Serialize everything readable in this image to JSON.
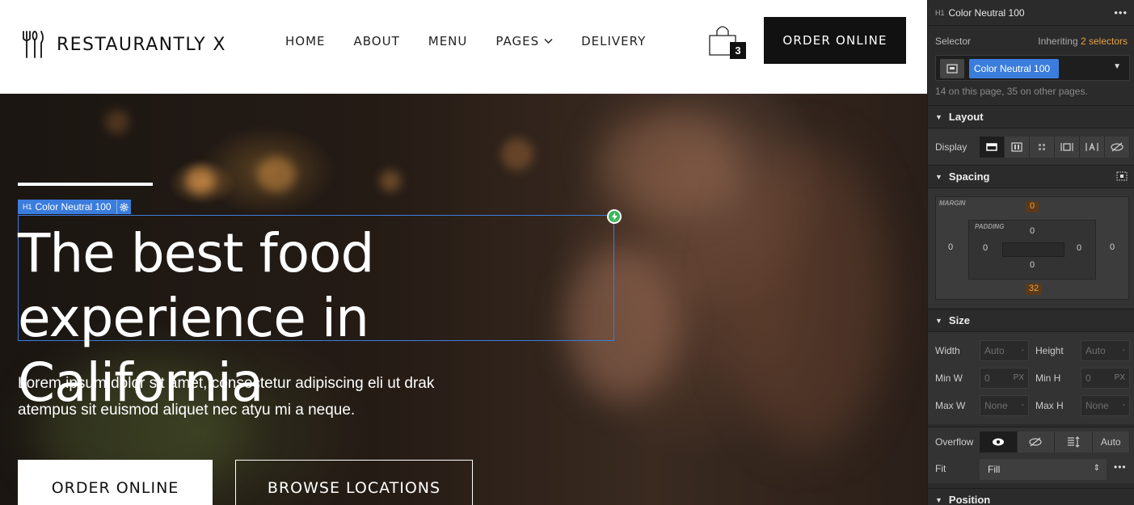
{
  "site": {
    "logo_text": "RESTAURANTLY X",
    "nav": [
      "HOME",
      "ABOUT",
      "MENU",
      "PAGES",
      "DELIVERY"
    ],
    "cart_count": "3",
    "order_button": "ORDER ONLINE"
  },
  "hero": {
    "selected_tag_type": "H1",
    "selected_tag_name": "Color Neutral 100",
    "heading_line1": "The best food",
    "heading_line2": "experience in California",
    "paragraph_line1": "Lorem ipsum dolor sit amet, consectetur adipiscing eli ut drak",
    "paragraph_line2": "atempus sit euismod aliquet nec atyu mi a neque.",
    "order_button": "ORDER ONLINE",
    "browse_button": "BROWSE LOCATIONS"
  },
  "panel": {
    "header_type": "H1",
    "header_name": "Color Neutral 100",
    "selector_label": "Selector",
    "inheriting_prefix": "Inheriting",
    "inheriting_count": "2 selectors",
    "selector_token": "Color Neutral 100",
    "usage_text": "14 on this page, 35 on other pages.",
    "sections": {
      "layout": "Layout",
      "spacing": "Spacing",
      "size": "Size",
      "position": "Position"
    },
    "display_label": "Display",
    "spacing": {
      "margin_label": "MARGIN",
      "padding_label": "PADDING",
      "margin_top": "0",
      "margin_right": "0",
      "margin_bottom": "32",
      "margin_left": "0",
      "padding_top": "0",
      "padding_right": "0",
      "padding_bottom": "0",
      "padding_left": "0"
    },
    "size": {
      "width_label": "Width",
      "width_value": "Auto",
      "height_label": "Height",
      "height_value": "Auto",
      "minw_label": "Min W",
      "minw_value": "0",
      "minw_unit": "PX",
      "minh_label": "Min H",
      "minh_value": "0",
      "minh_unit": "PX",
      "maxw_label": "Max W",
      "maxw_value": "None",
      "maxh_label": "Max H",
      "maxh_value": "None",
      "dash": "-"
    },
    "overflow_label": "Overflow",
    "overflow_auto": "Auto",
    "fit_label": "Fit",
    "fit_value": "Fill"
  },
  "colors": {
    "accent_blue": "#3b7ddd",
    "orange": "#e8a042",
    "panel_bg": "#2b2b2b",
    "handle_green": "#3ab75a"
  },
  "icons": {
    "logo": "fork-spoon-knife-icon",
    "pages_caret": "chevron-down-icon",
    "cart": "shopping-bag-icon",
    "selector": "style-selector-icon",
    "tag_settings": "gear-icon",
    "handle": "lightning-icon",
    "overflow_visible": "eye-icon",
    "overflow_hidden": "eye-off-icon",
    "overflow_scroll": "scroll-icon"
  }
}
